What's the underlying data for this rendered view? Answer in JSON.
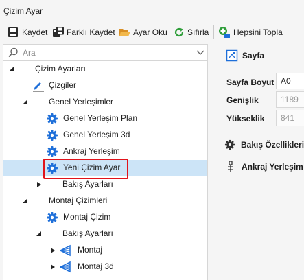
{
  "window": {
    "title": "Çizim Ayar"
  },
  "toolbar": {
    "save": "Kaydet",
    "save_as": "Farklı Kaydet",
    "open": "Ayar Oku",
    "reset": "Sıfırla",
    "collapse_all": "Hepsini Topla"
  },
  "search": {
    "placeholder": "Ara"
  },
  "tree": {
    "items": [
      {
        "label": "Çizim Ayarları",
        "expanded": true
      },
      {
        "label": "Çizgiler",
        "icon": "pen-icon"
      },
      {
        "label": "Genel Yerleşimler",
        "expanded": true
      },
      {
        "label": "Genel Yerleşim Plan",
        "icon": "gear-icon"
      },
      {
        "label": "Genel Yerleşim 3d",
        "icon": "gear-icon"
      },
      {
        "label": "Ankraj Yerleşim",
        "icon": "gear-icon"
      },
      {
        "label": "Yeni Çizim Ayar",
        "icon": "gear-icon",
        "selected": true
      },
      {
        "label": "Bakış Ayarları",
        "expanded": false
      },
      {
        "label": "Montaj Çizimleri",
        "expanded": true
      },
      {
        "label": "Montaj Çizim",
        "icon": "gear-icon"
      },
      {
        "label": "Bakış Ayarları",
        "expanded": true
      },
      {
        "label": "Montaj",
        "icon": "view-cone-icon",
        "expanded": false
      },
      {
        "label": "Montaj 3d",
        "icon": "view-cone-icon",
        "expanded": false
      }
    ]
  },
  "properties": {
    "page_section": "Sayfa",
    "page_size_label": "Sayfa Boyut",
    "page_size_value": "A0",
    "width_label": "Genişlik",
    "width_value": "1189",
    "height_label": "Yükseklik",
    "height_value": "841",
    "view_props_section": "Bakış Özellikleri",
    "anchor_section": "Ankraj Yerleşim"
  },
  "colors": {
    "selection": "#cce4f7",
    "highlight_border": "#e1131b",
    "accent_blue": "#1e6fd9",
    "reset_green": "#2f9e3a",
    "folder_orange": "#e8a33d"
  }
}
